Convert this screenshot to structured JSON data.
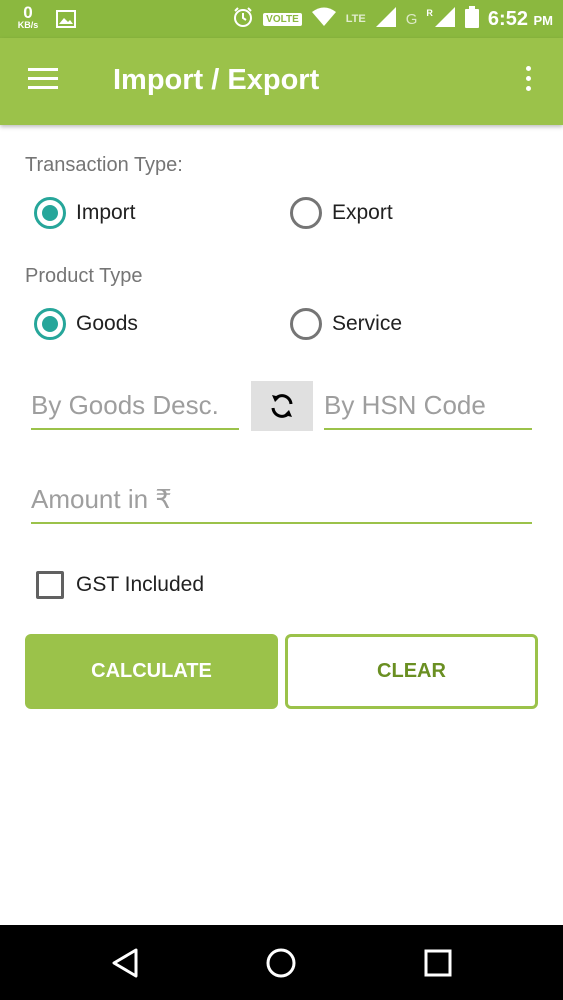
{
  "status_bar": {
    "speed_value": "0",
    "speed_unit": "KB/s",
    "volte": "VOLTE",
    "lte": "LTE",
    "g": "G",
    "roaming": "R",
    "time": "6:52",
    "ampm": "PM"
  },
  "app_bar": {
    "title": "Import / Export"
  },
  "transaction": {
    "label": "Transaction Type:",
    "options": [
      "Import",
      "Export"
    ],
    "selected": "Import"
  },
  "product": {
    "label": "Product Type",
    "options": [
      "Goods",
      "Service"
    ],
    "selected": "Goods"
  },
  "inputs": {
    "goods_desc_placeholder": "By Goods Desc.",
    "hsn_placeholder": "By HSN Code",
    "amount_placeholder": "Amount in ₹"
  },
  "gst": {
    "label": "GST Included",
    "checked": false
  },
  "buttons": {
    "calculate": "CALCULATE",
    "clear": "CLEAR"
  },
  "colors": {
    "primary": "#9bc24a",
    "status_bar": "#8bb83f",
    "radio_accent": "#26a69a"
  },
  "icons": [
    "menu-icon",
    "overflow-icon",
    "swap-icon",
    "back-icon",
    "home-icon",
    "recents-icon"
  ]
}
